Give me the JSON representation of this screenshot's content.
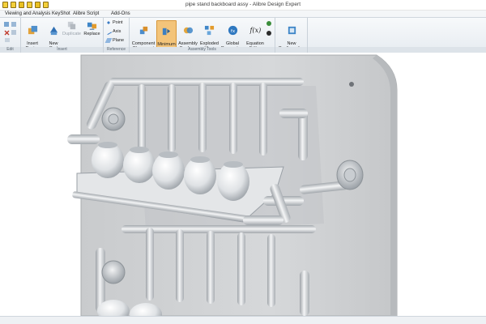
{
  "window": {
    "title": "pipe stand backboard assy - Alibre Design Expert"
  },
  "qat_icons": [
    "open-icon",
    "save-icon",
    "save-all-icon",
    "print-icon",
    "folder-icon",
    "undo-icon"
  ],
  "menu": {
    "tabs": [
      "Viewing and Analysis",
      "KeyShot",
      "Alibre Script",
      "Add-Ons"
    ]
  },
  "ribbon": {
    "groups": {
      "edit": "Edit",
      "insert": "Insert",
      "reference": "Reference",
      "assembly_tools": "Assembly Tools"
    },
    "buttons": {
      "insert_design": "Insert\nDesign",
      "new_part": "New\nPart",
      "duplicate": "Duplicate",
      "replace": "Replace",
      "point": "Point",
      "axis": "Axis",
      "plane": "Plane",
      "component_placement": "Component\nPlacement",
      "minimum_motion": "Minimum\nMotion",
      "assembly_boolean": "Assembly\nBoolean",
      "exploded_view": "Exploded\nView",
      "global_parameters": "Global\nParameters",
      "equation_editor": "Equation\nEditor",
      "new_configuration": "New\nConfiguration"
    },
    "equation_symbol": "f(x)"
  },
  "colors": {
    "accent_active": "#f3c47a",
    "ribbon_bg": "#eef2f5",
    "backboard": "#d2d4d6",
    "pipe": "#dfe2e5"
  }
}
